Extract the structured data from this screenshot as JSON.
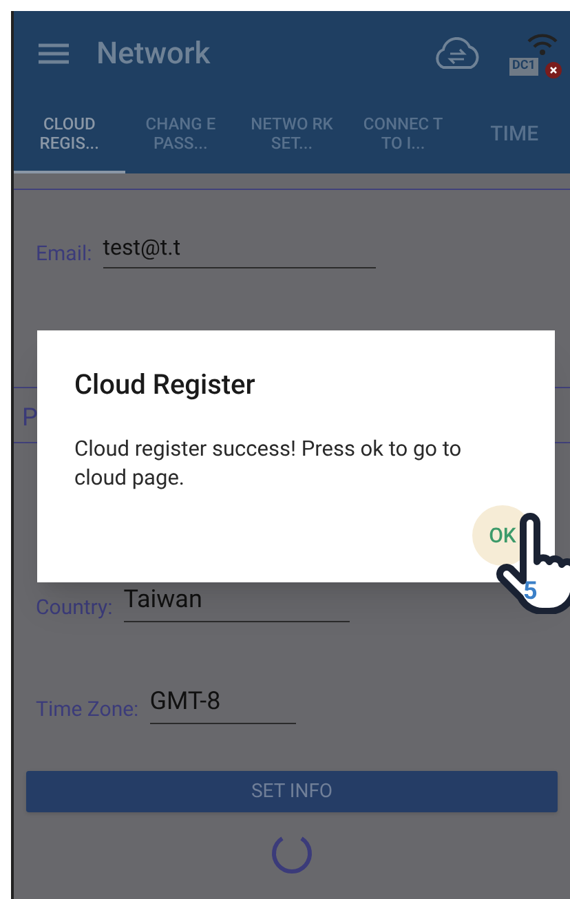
{
  "app_bar": {
    "title": "Network",
    "device_badge": "DC1"
  },
  "tabs": [
    {
      "label": "CLOUD REGIS...",
      "selected": true
    },
    {
      "label": "CHANG E PASS...",
      "selected": false
    },
    {
      "label": "NETWO RK SET...",
      "selected": false
    },
    {
      "label": "CONNEC T TO I...",
      "selected": false
    },
    {
      "label": "TIME",
      "selected": false
    }
  ],
  "form": {
    "email": {
      "label": "Email:",
      "value": "test@t.t"
    },
    "section_heading": "P",
    "country": {
      "label": "Country:",
      "value": "Taiwan"
    },
    "time_zone": {
      "label": "Time Zone:",
      "value": "GMT-8"
    },
    "submit": "SET INFO",
    "loading": true
  },
  "dialog": {
    "title": "Cloud Register",
    "message": "Cloud register success! Press ok to go to cloud page.",
    "ok": "OK"
  },
  "tutorial_pointer": {
    "step": "5"
  }
}
